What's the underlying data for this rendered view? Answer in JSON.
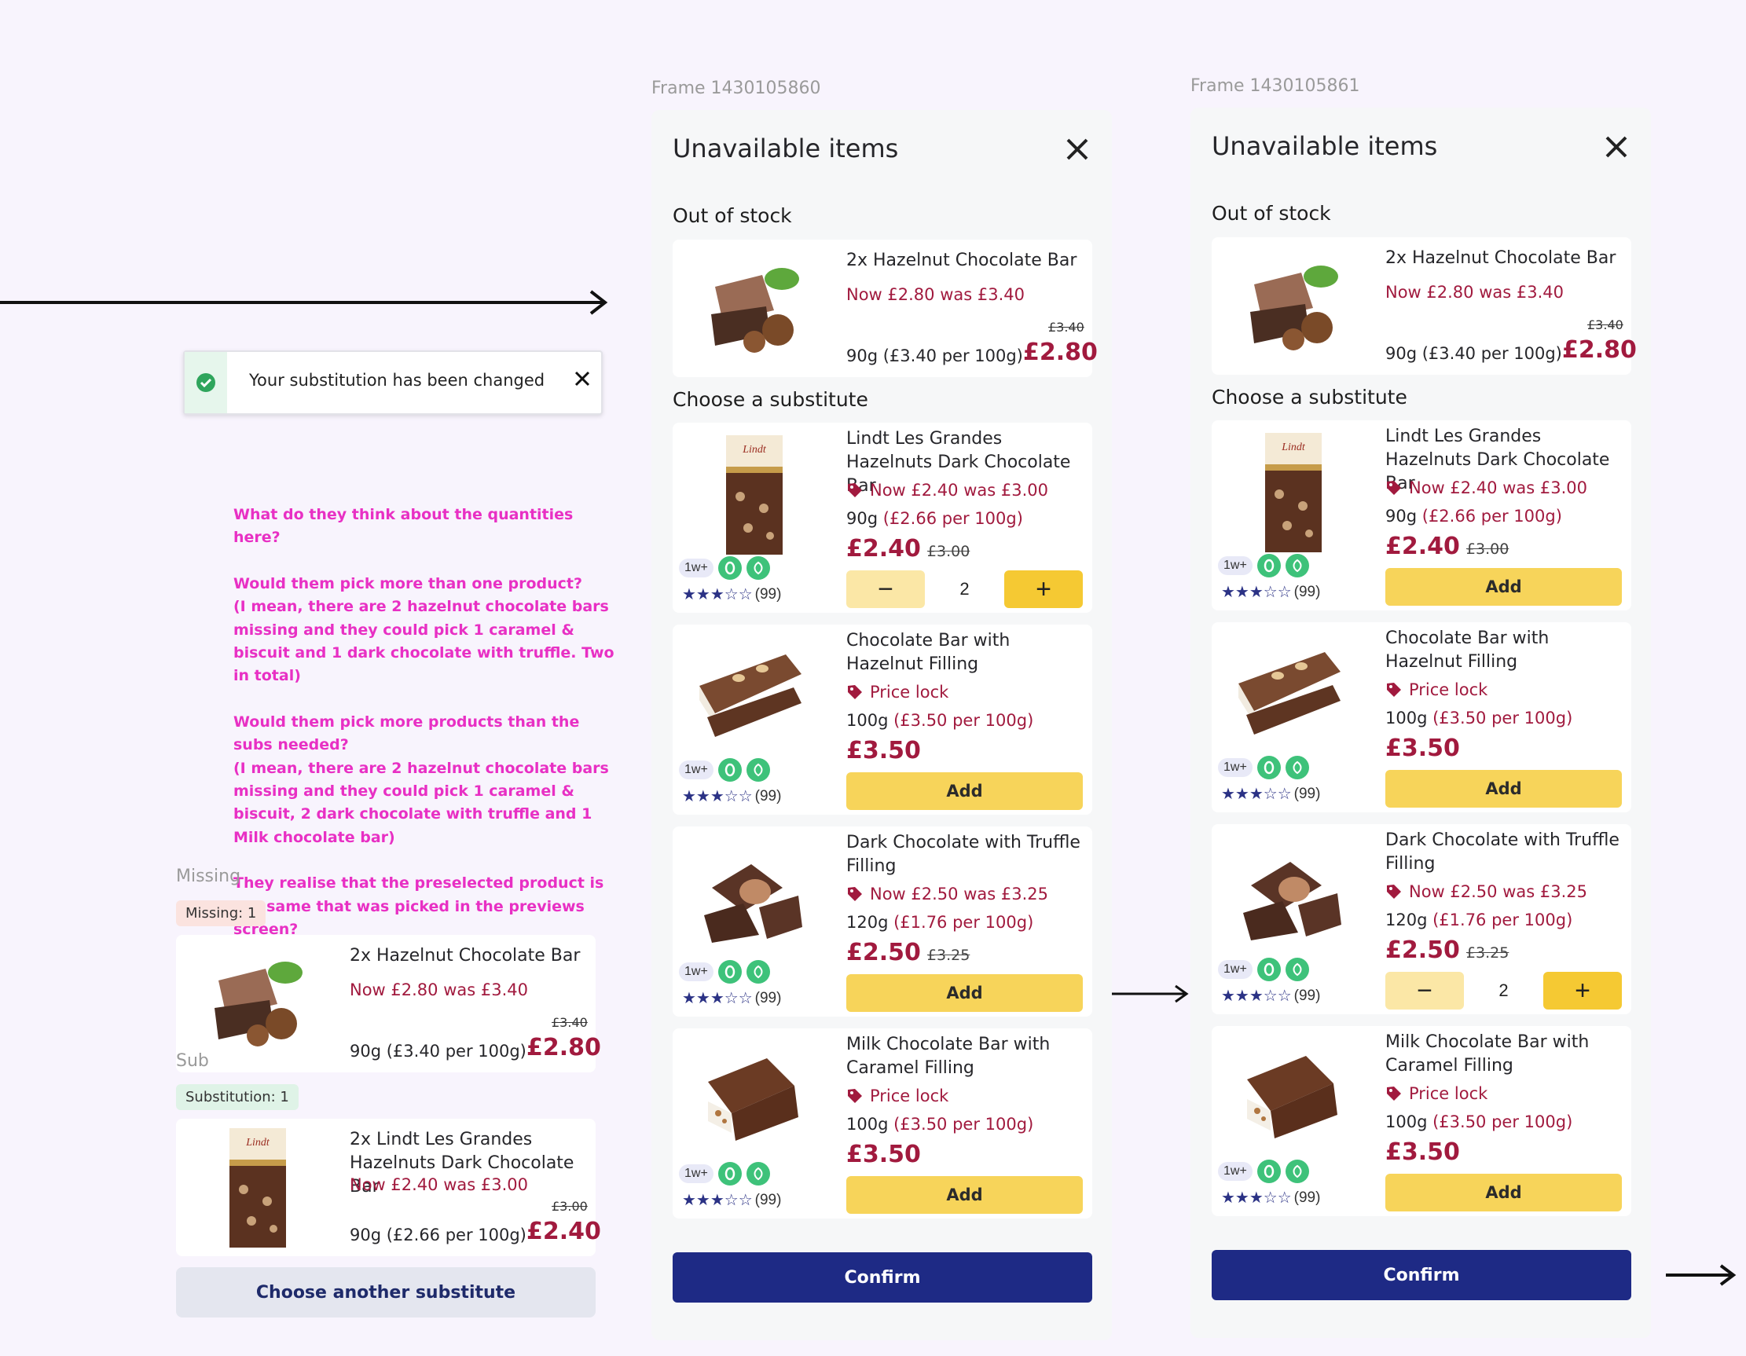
{
  "frame_labels": {
    "left": "Frame 1430105860",
    "right": "Frame 1430105861"
  },
  "modal": {
    "title": "Unavailable items",
    "out_of_stock": "Out of stock",
    "choose": "Choose a substitute",
    "confirm": "Confirm"
  },
  "oos_item": {
    "name": "2x Hazelnut Chocolate Bar",
    "promo": "Now £2.80 was £3.40",
    "weight": "90g (£3.40 per 100g)",
    "was": "£3.40",
    "price": "£2.80"
  },
  "subs": [
    {
      "name": "Lindt Les Grandes Hazelnuts Dark Chocolate Bar",
      "promo": "Now  £2.40 was £3.00",
      "weight": "90g",
      "unit": "(£2.66 per 100g)",
      "price": "£2.40",
      "was": "£3.00",
      "qty": "2"
    },
    {
      "name": "Chocolate Bar with Hazelnut Filling",
      "promo": "Price lock",
      "weight": "100g",
      "unit": "(£3.50 per 100g)",
      "price": "£3.50",
      "was": ""
    },
    {
      "name": "Dark Chocolate with Truffle Filling",
      "promo": "Now  £2.50 was £3.25",
      "weight": "120g",
      "unit": "(£1.76 per 100g)",
      "price": "£2.50",
      "was": "£3.25",
      "qty": "2"
    },
    {
      "name": "Milk Chocolate Bar with Caramel Filling",
      "promo": "Price lock",
      "weight": "100g",
      "unit": "(£3.50 per 100g)",
      "price": "£3.50",
      "was": ""
    }
  ],
  "add_label": "Add",
  "badge_1w": "1w+",
  "stars": "★★★☆☆",
  "review_count": "(99)",
  "toast": {
    "text": "Your substitution has been changed"
  },
  "notes": [
    "What do they think about the quantities here?",
    "Would them pick more than one product?\n(I mean, there are 2 hazelnut chocolate bars missing and they could pick 1 caramel & biscuit and 1 dark chocolate with truffle. Two in total)",
    "Would them pick more products than the subs needed?\n(I mean, there are 2 hazelnut chocolate bars missing and they could pick 1 caramel & biscuit, 2 dark chocolate with truffle and 1 Milk chocolate bar)",
    "They realise that the preselected product is the same that was picked in the previews screen?"
  ],
  "left_panel": {
    "missing_label": "Missing",
    "missing_chip": "Missing: 1",
    "sub_label": "Sub",
    "sub_chip": "Substitution: 1",
    "missing_item": {
      "name": "2x Hazelnut Chocolate Bar",
      "promo": "Now £2.80 was £3.40",
      "weight": "90g (£3.40 per 100g)",
      "was": "£3.40",
      "price": "£2.80"
    },
    "sub_item": {
      "name": "2x Lindt Les Grandes Hazelnuts Dark Chocolate Bar",
      "promo": "Now £2.40 was £3.00",
      "weight": "90g (£2.66 per 100g)",
      "was": "£3.00",
      "price": "£2.40"
    },
    "button": "Choose another substitute"
  },
  "colors": {
    "accent": "#a11a3e",
    "confirm": "#1e2a85",
    "add": "#f7d45a",
    "note": "#e830c4"
  }
}
